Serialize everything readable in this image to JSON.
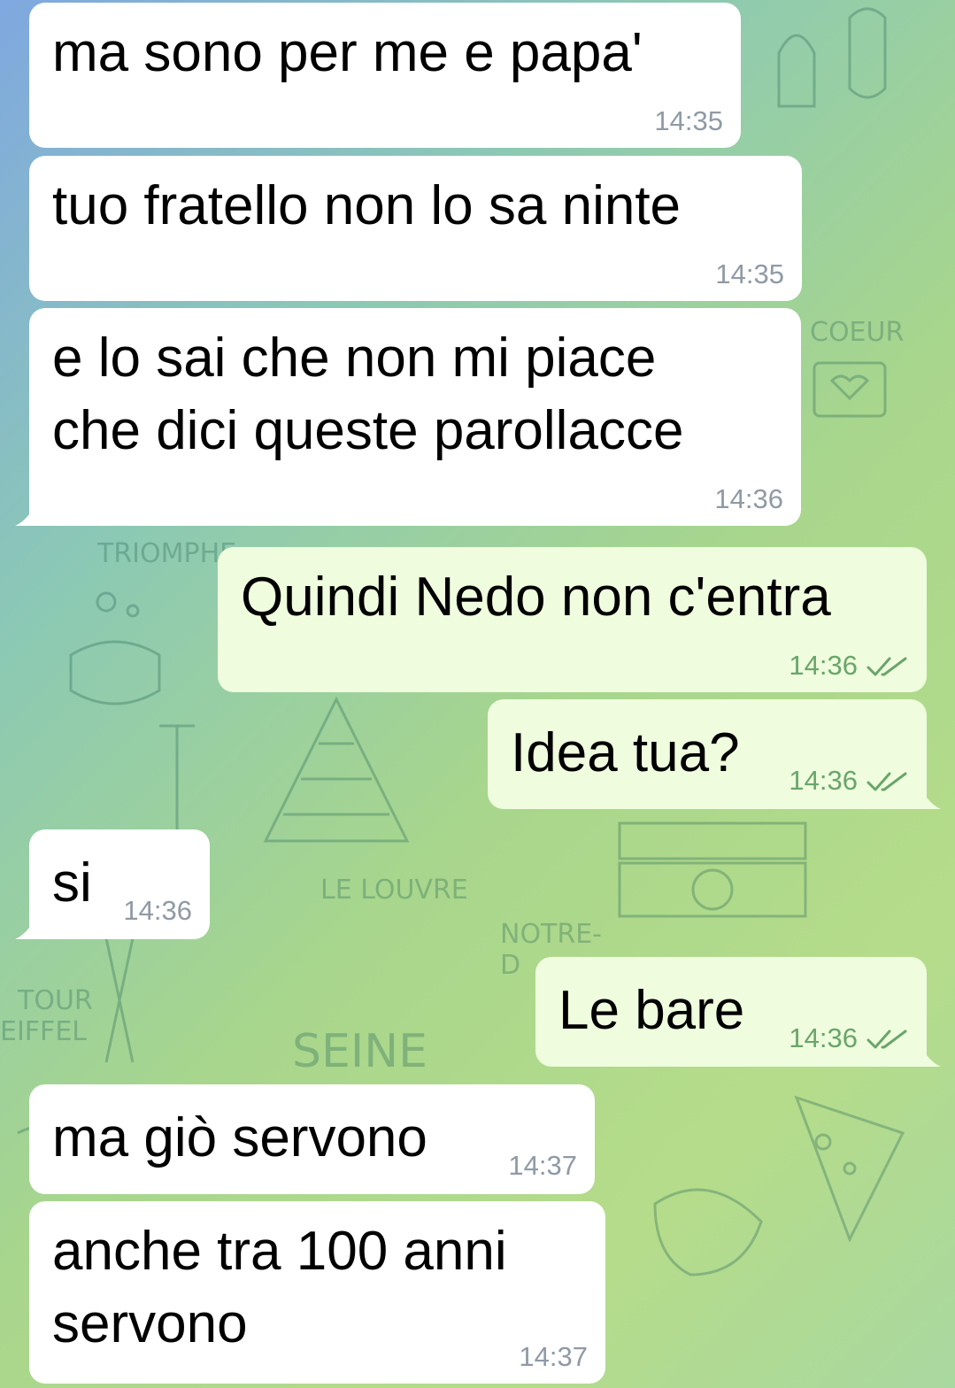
{
  "messages": [
    {
      "id": "m1",
      "direction": "incoming",
      "text": "ma sono per me e papa'",
      "time": "14:35"
    },
    {
      "id": "m2",
      "direction": "incoming",
      "text": "tuo fratello non lo sa ninte",
      "time": "14:35"
    },
    {
      "id": "m3",
      "direction": "incoming",
      "text": "e lo sai che non mi piace\nche dici queste parollacce",
      "time": "14:36"
    },
    {
      "id": "m4",
      "direction": "outgoing",
      "text": "Quindi Nedo non c'entra",
      "time": "14:36",
      "status": "read"
    },
    {
      "id": "m5",
      "direction": "outgoing",
      "text": "Idea tua?",
      "time": "14:36",
      "status": "read"
    },
    {
      "id": "m6",
      "direction": "incoming",
      "text": "si",
      "time": "14:36"
    },
    {
      "id": "m7",
      "direction": "outgoing",
      "text": "Le bare",
      "time": "14:36",
      "status": "read"
    },
    {
      "id": "m8",
      "direction": "incoming",
      "text": "ma giò servono",
      "time": "14:37"
    },
    {
      "id": "m9",
      "direction": "incoming",
      "text": "anche tra 100 anni\nservono",
      "time": "14:37"
    }
  ],
  "background": {
    "labels": [
      "TRIOMPHE",
      "LE LOUVRE",
      "NOTRE-",
      "D",
      "SEINE",
      "TOUR",
      "EIFFEL",
      "COEUR"
    ]
  },
  "colors": {
    "incoming_bubble": "#ffffff",
    "outgoing_bubble": "#effdde",
    "time_incoming": "#8f9aa4",
    "time_outgoing": "#6aa56a",
    "read_check": "#6aa56a"
  },
  "icons": {
    "read_status": "double-check-icon"
  }
}
